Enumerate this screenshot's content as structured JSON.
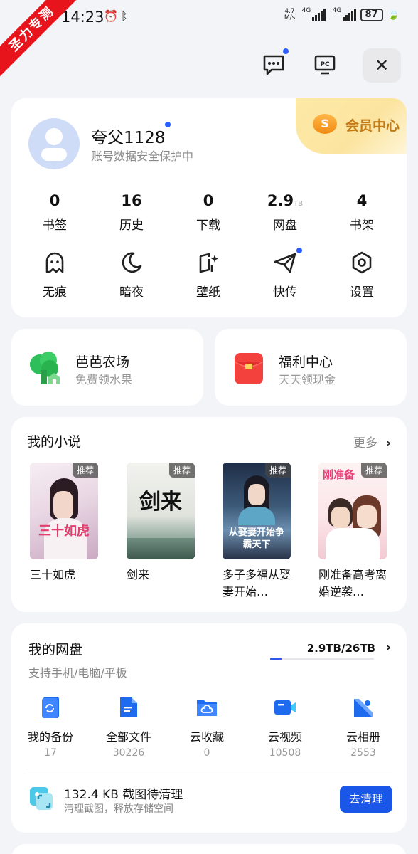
{
  "ribbon": "圣力专测",
  "status": {
    "time": "14:23",
    "net_speed": "4.7",
    "net_unit": "M/s",
    "sig1": "4G",
    "sig2": "4G",
    "battery": "87"
  },
  "profile": {
    "username": "夸父1128",
    "subtitle": "账号数据安全保护中",
    "vip_label": "会员中心",
    "vip_coin": "S",
    "stats": [
      {
        "value": "0",
        "unit": "",
        "label": "书签"
      },
      {
        "value": "16",
        "unit": "",
        "label": "历史"
      },
      {
        "value": "0",
        "unit": "",
        "label": "下载"
      },
      {
        "value": "2.9",
        "unit": "TB",
        "label": "网盘"
      },
      {
        "value": "4",
        "unit": "",
        "label": "书架"
      }
    ],
    "tools": [
      {
        "label": "无痕",
        "icon": "ghost-icon"
      },
      {
        "label": "暗夜",
        "icon": "moon-icon"
      },
      {
        "label": "壁纸",
        "icon": "wallpaper-icon"
      },
      {
        "label": "快传",
        "icon": "paper-plane-icon"
      },
      {
        "label": "设置",
        "icon": "settings-icon"
      }
    ]
  },
  "farm": {
    "title": "芭芭农场",
    "subtitle": "免费领水果"
  },
  "welfare": {
    "title": "福利中心",
    "subtitle": "天天领现金"
  },
  "novels": {
    "title": "我的小说",
    "more": "更多",
    "books": [
      {
        "title": "三十如虎",
        "tag": "推荐",
        "cover_text": "三十如虎"
      },
      {
        "title": "剑来",
        "tag": "推荐",
        "cover_text": "剑来"
      },
      {
        "title": "多子多福从娶妻开始…",
        "tag": "推荐",
        "cover_text": "从娶妻开始争霸天下"
      },
      {
        "title": "刚准备高考离婚逆袭…",
        "tag": "推荐",
        "cover_text": "刚准备"
      }
    ]
  },
  "cloud": {
    "title": "我的网盘",
    "subtitle": "支持手机/电脑/平板",
    "quota": "2.9TB/26TB",
    "quota_fraction": 0.11,
    "categories": [
      {
        "label": "我的备份",
        "count": "17"
      },
      {
        "label": "全部文件",
        "count": "30226"
      },
      {
        "label": "云收藏",
        "count": "0"
      },
      {
        "label": "云视频",
        "count": "10508"
      },
      {
        "label": "云相册",
        "count": "2553"
      }
    ],
    "clean_title": "132.4 KB 截图待清理",
    "clean_subtitle": "清理截图，释放存储空间",
    "clean_button": "去清理"
  }
}
